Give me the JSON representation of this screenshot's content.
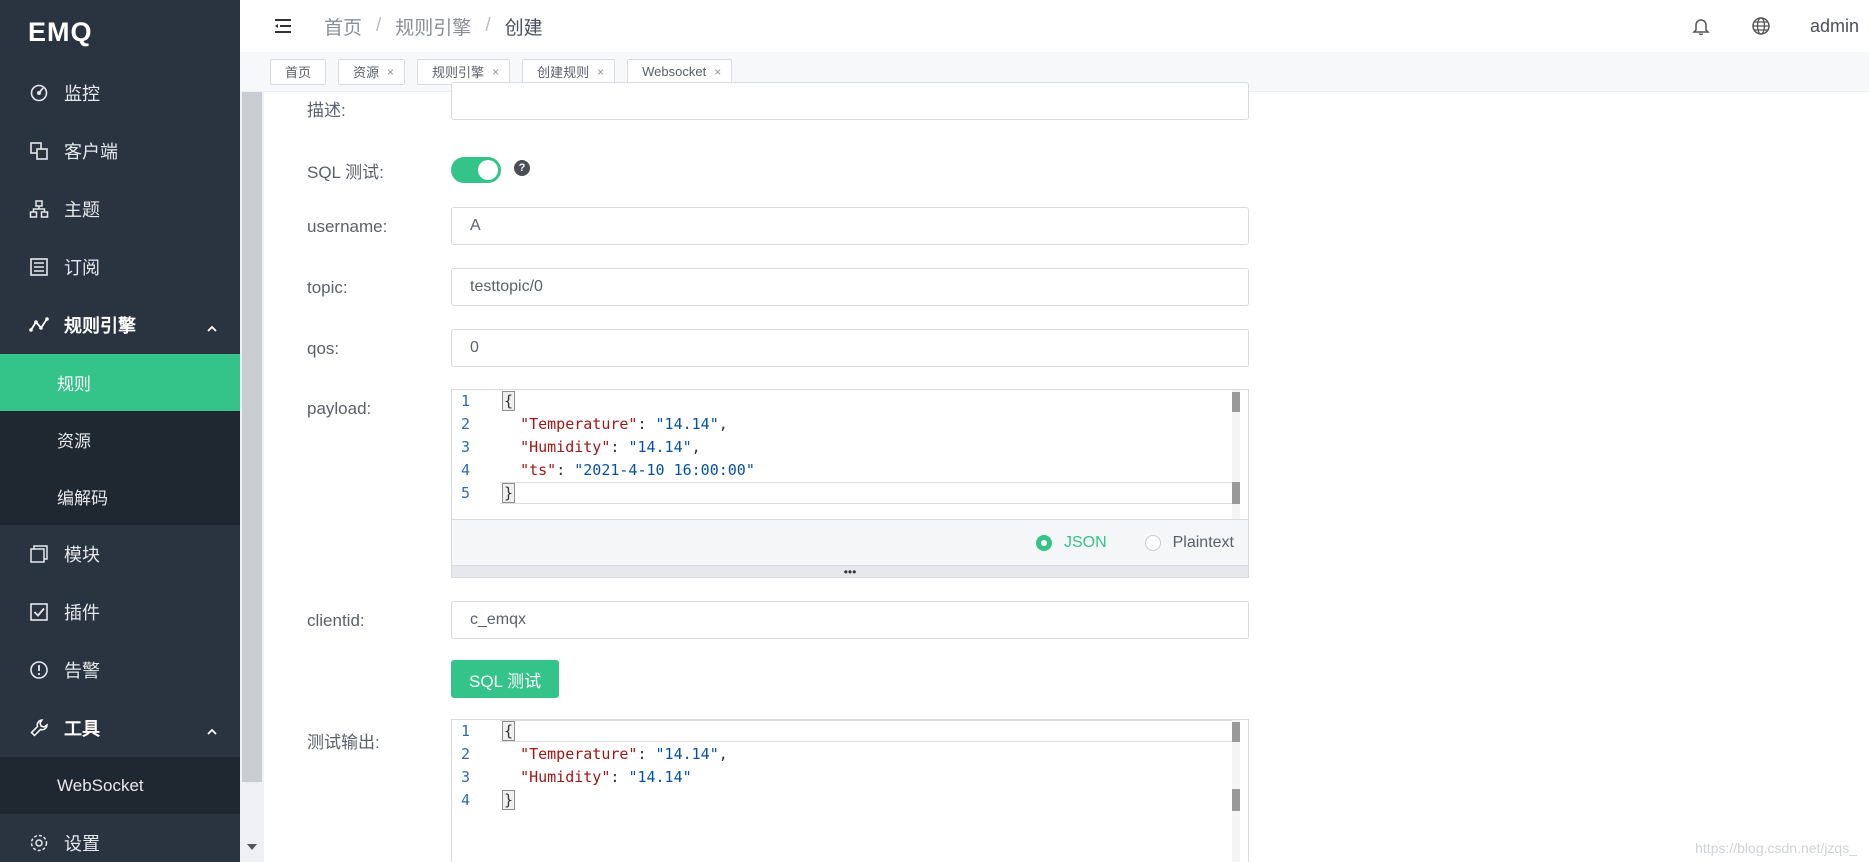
{
  "brand": "EMQ",
  "sidebar": {
    "items": [
      {
        "label": "监控",
        "icon": "dashboard-icon"
      },
      {
        "label": "客户端",
        "icon": "clients-icon"
      },
      {
        "label": "主题",
        "icon": "topics-icon"
      },
      {
        "label": "订阅",
        "icon": "subscriptions-icon"
      },
      {
        "label": "规则引擎",
        "icon": "rule-engine-icon",
        "expanded": true,
        "children": [
          {
            "label": "规则",
            "active": true
          },
          {
            "label": "资源"
          },
          {
            "label": "编解码"
          }
        ]
      },
      {
        "label": "模块",
        "icon": "modules-icon"
      },
      {
        "label": "插件",
        "icon": "plugins-icon"
      },
      {
        "label": "告警",
        "icon": "alarm-icon"
      },
      {
        "label": "工具",
        "icon": "tools-icon",
        "expanded": true,
        "children": [
          {
            "label": "WebSocket"
          }
        ]
      },
      {
        "label": "设置",
        "icon": "settings-icon"
      }
    ]
  },
  "header": {
    "breadcrumb": [
      "首页",
      "规则引擎",
      "创建"
    ],
    "user": "admin"
  },
  "tags": [
    "首页",
    "资源",
    "规则引擎",
    "创建规则",
    "Websocket"
  ],
  "form": {
    "description_label": "描述:",
    "sql_test_label": "SQL 测试:",
    "sql_test_enabled": true,
    "username_label": "username:",
    "username_value": "A",
    "topic_label": "topic:",
    "topic_value": "testtopic/0",
    "qos_label": "qos:",
    "qos_value": "0",
    "payload_label": "payload:",
    "payload_lines": [
      "{",
      "  \"Temperature\": \"14.14\",",
      "  \"Humidity\": \"14.14\",",
      "  \"ts\": \"2021-4-10 16:00:00\"",
      "}"
    ],
    "format_options": [
      {
        "label": "JSON",
        "checked": true
      },
      {
        "label": "Plaintext",
        "checked": false
      }
    ],
    "clientid_label": "clientid:",
    "clientid_value": "c_emqx",
    "sql_test_button": "SQL 测试",
    "output_label": "测试输出:",
    "output_lines": [
      "{",
      "  \"Temperature\": \"14.14\",",
      "  \"Humidity\": \"14.14\"",
      "}"
    ]
  },
  "watermark": "https://blog.csdn.net/jzqs_",
  "colors": {
    "accent": "#34c388",
    "sidebar_bg": "#293440",
    "submenu_bg": "#1f2731"
  }
}
